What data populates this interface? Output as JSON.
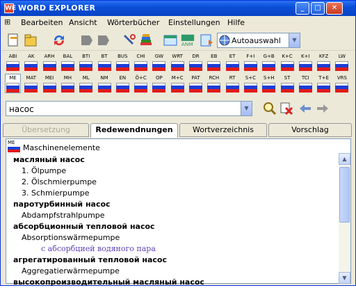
{
  "window": {
    "title": "WORD EXPLORER",
    "app_icon": "WE",
    "controls": [
      "minimize-icon",
      "maximize-icon",
      "close-icon"
    ]
  },
  "menu": {
    "items": [
      "Bearbeiten",
      "Ansicht",
      "Wörterbücher",
      "Einstellungen",
      "Hilfe"
    ]
  },
  "toolbar": {
    "buttons": [
      "new-icon",
      "open-icon",
      "refresh-icon",
      "back-icon",
      "forward-icon",
      "tools-icon",
      "books-icon",
      "card-icon",
      "anm-icon",
      "translate-icon"
    ],
    "anm_label": "ANM",
    "dropdown_value": "Autoauswahl"
  },
  "dictionaries": {
    "row1": [
      "ABI",
      "AK",
      "ARH",
      "BAL",
      "BTI",
      "BT",
      "BUS",
      "CHI",
      "GW",
      "WRT",
      "DR",
      "EB",
      "ET",
      "F+I",
      "G+B",
      "K+C",
      "K+I",
      "KFZ",
      "LW"
    ],
    "row2": [
      "ME",
      "MAT",
      "MEI",
      "MH",
      "ML",
      "NM",
      "EN",
      "Ö+C",
      "OP",
      "M+C",
      "PAT",
      "RCH",
      "RT",
      "S+C",
      "S+H",
      "ST",
      "TCI",
      "T+E",
      "VRS"
    ],
    "active": "ME"
  },
  "search": {
    "value": "насос"
  },
  "tabs": {
    "items": [
      "Übersetzung",
      "Redewendnungen",
      "Wortverzeichnis",
      "Vorschlag"
    ],
    "active": "Redewendnungen"
  },
  "results": {
    "source_code": "ME",
    "source_name": "Maschinenelemente",
    "rows": [
      {
        "type": "head",
        "text": "масляный насос"
      },
      {
        "type": "subnum",
        "text": "1. Ölpumpe"
      },
      {
        "type": "subnum",
        "text": "2. Ölschmierpumpe"
      },
      {
        "type": "subnum",
        "text": "3. Schmierpumpe"
      },
      {
        "type": "head",
        "text": "паротурбинный насос"
      },
      {
        "type": "sub",
        "text": "Abdampfstrahlpumpe"
      },
      {
        "type": "head",
        "text": "абсорбционный тепловой насос"
      },
      {
        "type": "sub",
        "text": "Absorptionswärmepumpe"
      },
      {
        "type": "note",
        "text": "с абсорбцией водяного пара"
      },
      {
        "type": "head",
        "text": "агрегатированный тепловой насос"
      },
      {
        "type": "sub",
        "text": "Aggregatierwärmepumpe"
      },
      {
        "type": "head",
        "text": "высокопроизводительный масляный насос"
      }
    ]
  }
}
